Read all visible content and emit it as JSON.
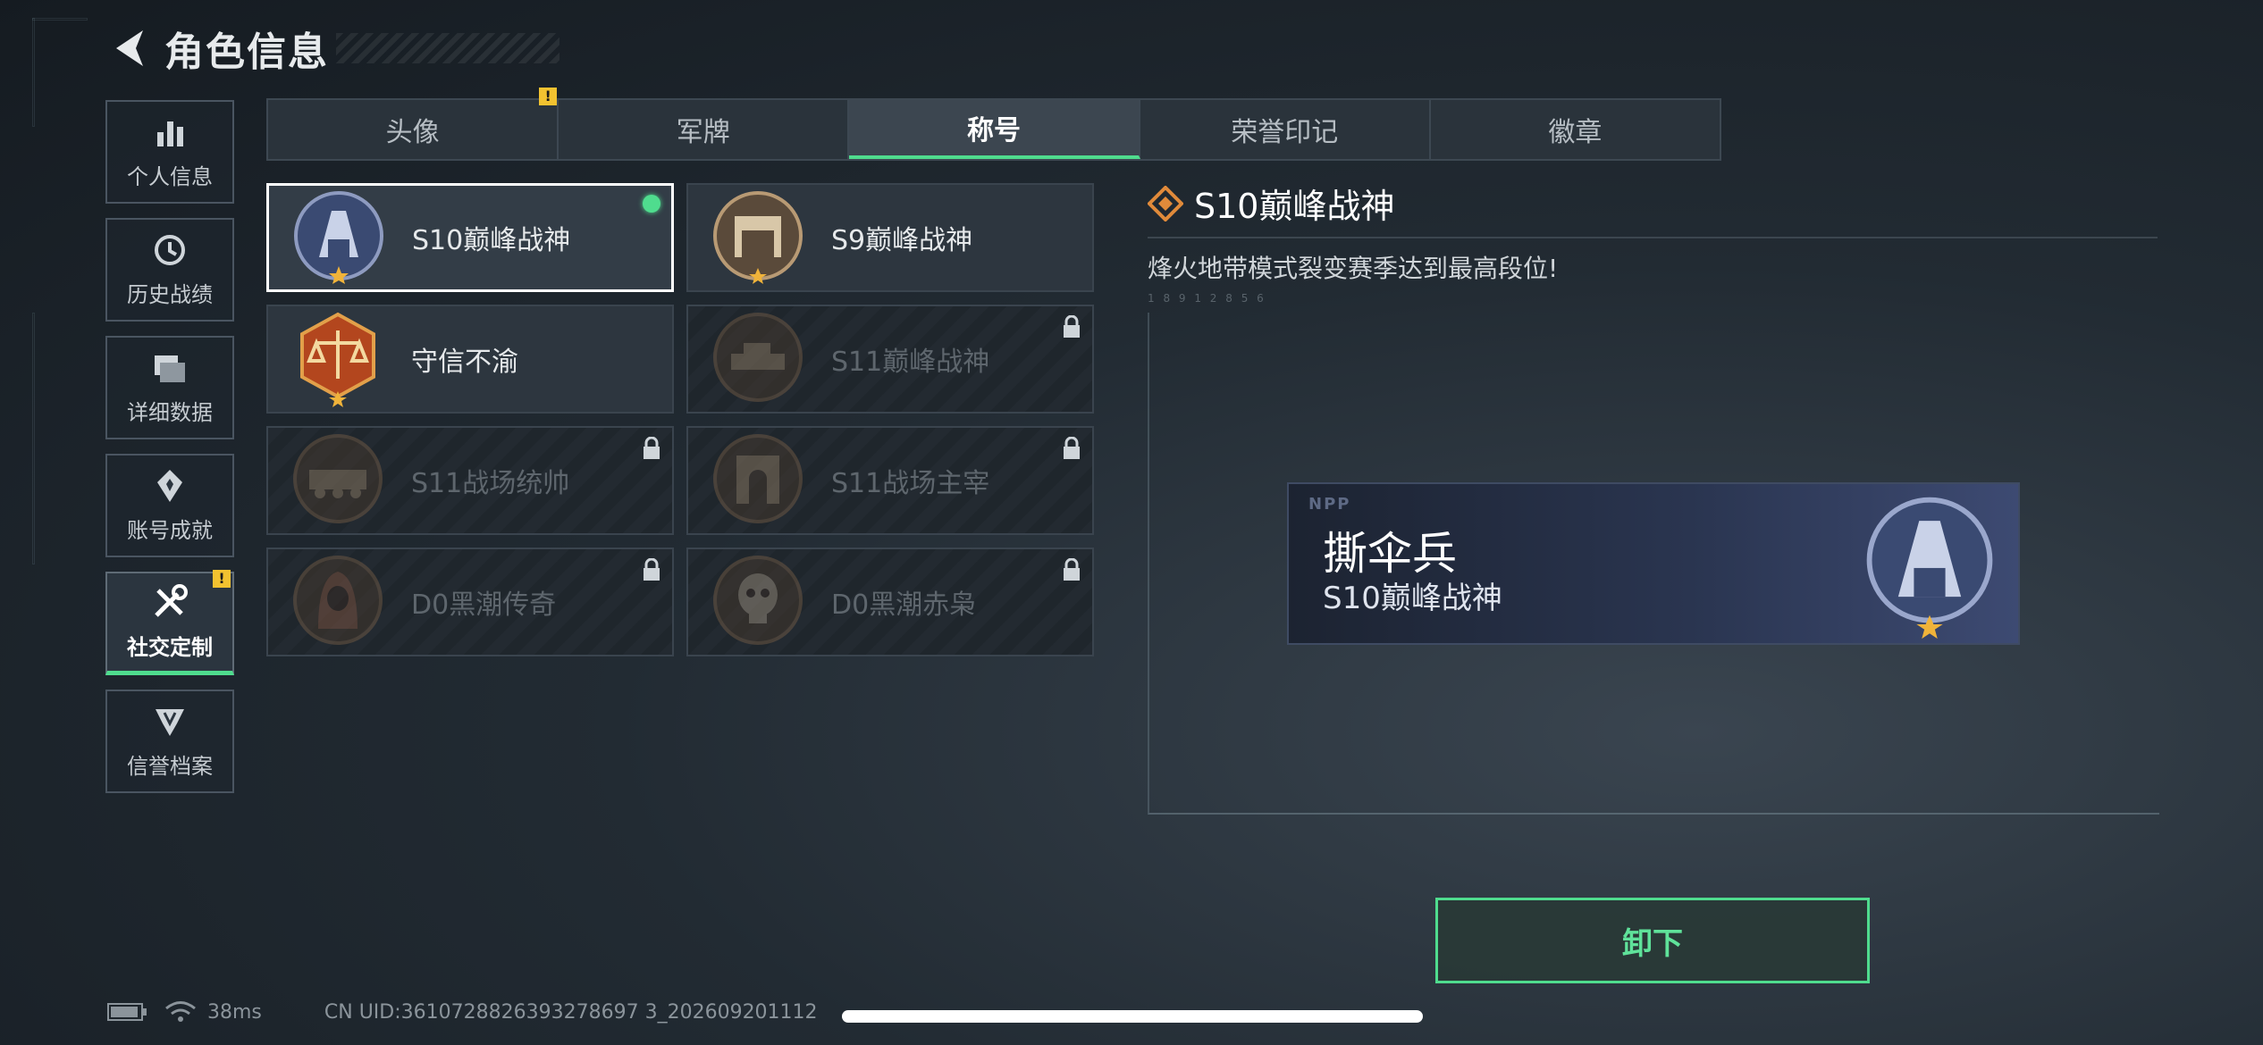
{
  "header": {
    "title": "角色信息"
  },
  "sidebar": {
    "items": [
      {
        "label": "个人信息",
        "icon": "bar-chart-icon",
        "active": false,
        "alert": false
      },
      {
        "label": "历史战绩",
        "icon": "history-icon",
        "active": false,
        "alert": false
      },
      {
        "label": "详细数据",
        "icon": "folder-icon",
        "active": false,
        "alert": false
      },
      {
        "label": "账号成就",
        "icon": "achievement-icon",
        "active": false,
        "alert": false
      },
      {
        "label": "社交定制",
        "icon": "tools-icon",
        "active": true,
        "alert": true
      },
      {
        "label": "信誉档案",
        "icon": "reputation-icon",
        "active": false,
        "alert": false
      }
    ],
    "alert_mark": "!"
  },
  "tabs": {
    "items": [
      {
        "label": "头像",
        "active": false,
        "alert": true
      },
      {
        "label": "军牌",
        "active": false,
        "alert": false
      },
      {
        "label": "称号",
        "active": true,
        "alert": false
      },
      {
        "label": "荣誉印记",
        "active": false,
        "alert": false
      },
      {
        "label": "徽章",
        "active": false,
        "alert": false
      }
    ]
  },
  "titles": {
    "items": [
      {
        "name": "S10巅峰战神",
        "locked": false,
        "selected": true,
        "equipped": true,
        "emblem": "peak-blue-emblem"
      },
      {
        "name": "S9巅峰战神",
        "locked": false,
        "selected": false,
        "equipped": false,
        "emblem": "peak-bronze-emblem"
      },
      {
        "name": "守信不渝",
        "locked": false,
        "selected": false,
        "equipped": false,
        "emblem": "scales-emblem"
      },
      {
        "name": "S11巅峰战神",
        "locked": true,
        "selected": false,
        "equipped": false,
        "emblem": "tank-emblem"
      },
      {
        "name": "S11战场统帅",
        "locked": true,
        "selected": false,
        "equipped": false,
        "emblem": "vehicle-emblem"
      },
      {
        "name": "S11战场主宰",
        "locked": true,
        "selected": false,
        "equipped": false,
        "emblem": "arch-emblem"
      },
      {
        "name": "D0黑潮传奇",
        "locked": true,
        "selected": false,
        "equipped": false,
        "emblem": "hooded-emblem"
      },
      {
        "name": "D0黑潮赤枭",
        "locked": true,
        "selected": false,
        "equipped": false,
        "emblem": "skull-emblem"
      }
    ]
  },
  "detail": {
    "title": "S10巅峰战神",
    "description": "烽火地带模式裂变赛季达到最高段位!",
    "faint_text": "1 8 9 1    2 8  5 6"
  },
  "nameplate": {
    "logo": "NPP",
    "player_name": "撕伞兵",
    "title": "S10巅峰战神"
  },
  "actions": {
    "unequip_label": "卸下"
  },
  "status": {
    "ping": "38ms",
    "uid": "CN UID:3610728826393278697 3_202609201112"
  },
  "colors": {
    "accent": "#4fdc8e",
    "alert": "#f2c230",
    "detail_icon": "#e08a3a"
  }
}
